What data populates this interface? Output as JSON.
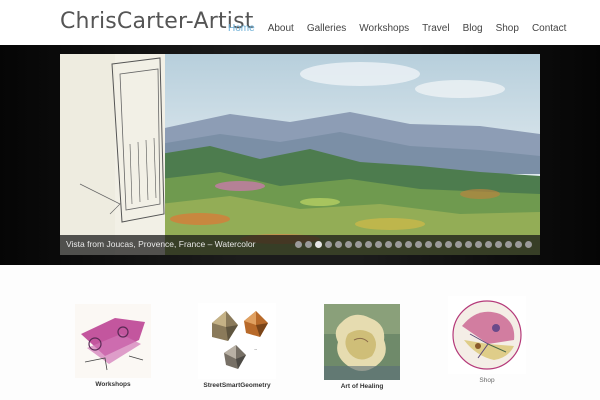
{
  "site": {
    "title": "ChrisCarter-Artist"
  },
  "nav": {
    "items": [
      "Home",
      "About",
      "Galleries",
      "Workshops",
      "Travel",
      "Blog",
      "Shop",
      "Contact"
    ],
    "active": "Home",
    "accent": "#6aaed6"
  },
  "slider": {
    "caption": "Vista from Joucas, Provence, France – Watercolor",
    "dot_count": 24,
    "active_dot": 2
  },
  "thumbnails": [
    {
      "label": "Workshops"
    },
    {
      "label": "StreetSmartGeometry"
    },
    {
      "label": "Art of Healing"
    },
    {
      "label": "Shop"
    }
  ]
}
